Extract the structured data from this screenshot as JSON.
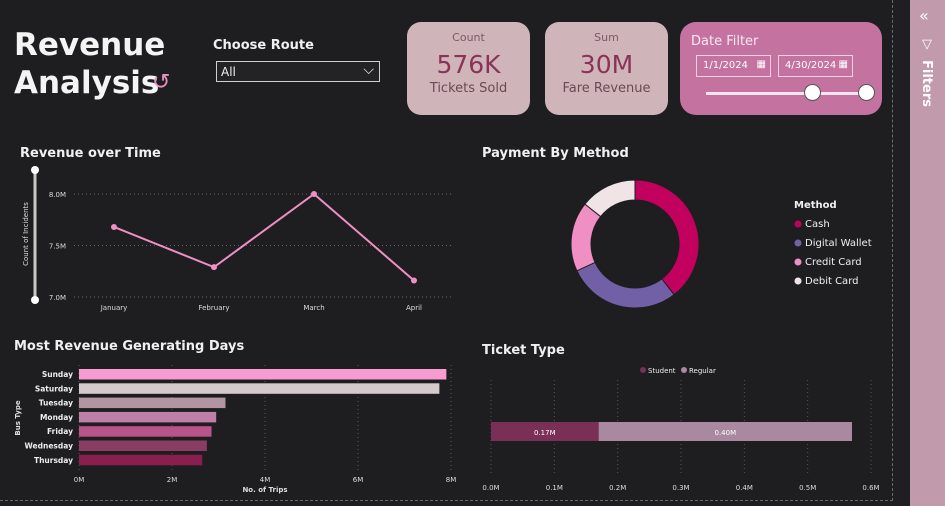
{
  "header": {
    "title_line1": "Revenue",
    "title_line2": "Analysis"
  },
  "route_filter": {
    "label": "Choose Route",
    "value": "All"
  },
  "cards": [
    {
      "small": "Count",
      "value": "576K",
      "caption": "Tickets Sold"
    },
    {
      "small": "Sum",
      "value": "30M",
      "caption": "Fare Revenue"
    }
  ],
  "date_filter": {
    "label": "Date Filter",
    "start": "1/1/2024",
    "end": "4/30/2024",
    "range_position": [
      0.66,
      1.0
    ]
  },
  "filters_pane": {
    "label": "Filters"
  },
  "colors": {
    "accent": "#c472a0",
    "line": "#f08fc4",
    "cash": "#c2005e",
    "digital": "#7260a6",
    "credit": "#f08fc4",
    "debit": "#f1e4e6"
  },
  "chart_data": [
    {
      "type": "line",
      "title": "Revenue over Time",
      "ylabel": "Count of Incidents",
      "categories": [
        "January",
        "February",
        "March",
        "April"
      ],
      "y_ticks": [
        "7.0M",
        "7.5M",
        "8.0M"
      ],
      "ylim": [
        7.0,
        8.0
      ],
      "values": [
        7.68,
        7.29,
        8.0,
        7.16
      ]
    },
    {
      "type": "pie",
      "title": "Payment By Method",
      "legend_title": "Method",
      "labels": [
        "Cash",
        "Digital Wallet",
        "Credit Card",
        "Debit Card"
      ],
      "values": [
        36,
        26,
        16,
        13
      ]
    },
    {
      "type": "bar",
      "title": "Most Revenue Generating Days",
      "xlabel": "No. of Trips",
      "ylabel": "Bus Type",
      "categories": [
        "Sunday",
        "Saturday",
        "Tuesday",
        "Monday",
        "Friday",
        "Wednesday",
        "Thursday"
      ],
      "values": [
        7.9,
        7.75,
        3.15,
        2.95,
        2.85,
        2.75,
        2.65
      ],
      "x_ticks": [
        "0M",
        "2M",
        "4M",
        "6M",
        "8M"
      ],
      "xlim": [
        0,
        8
      ]
    },
    {
      "type": "bar",
      "title": "Ticket Type",
      "series": [
        {
          "name": "Student",
          "value": 0.17,
          "label": "0.17M"
        },
        {
          "name": "Regular",
          "value": 0.4,
          "label": "0.40M"
        }
      ],
      "x_ticks": [
        "0.0M",
        "0.1M",
        "0.2M",
        "0.3M",
        "0.4M",
        "0.5M",
        "0.6M"
      ],
      "xlim": [
        0,
        0.6
      ]
    }
  ]
}
